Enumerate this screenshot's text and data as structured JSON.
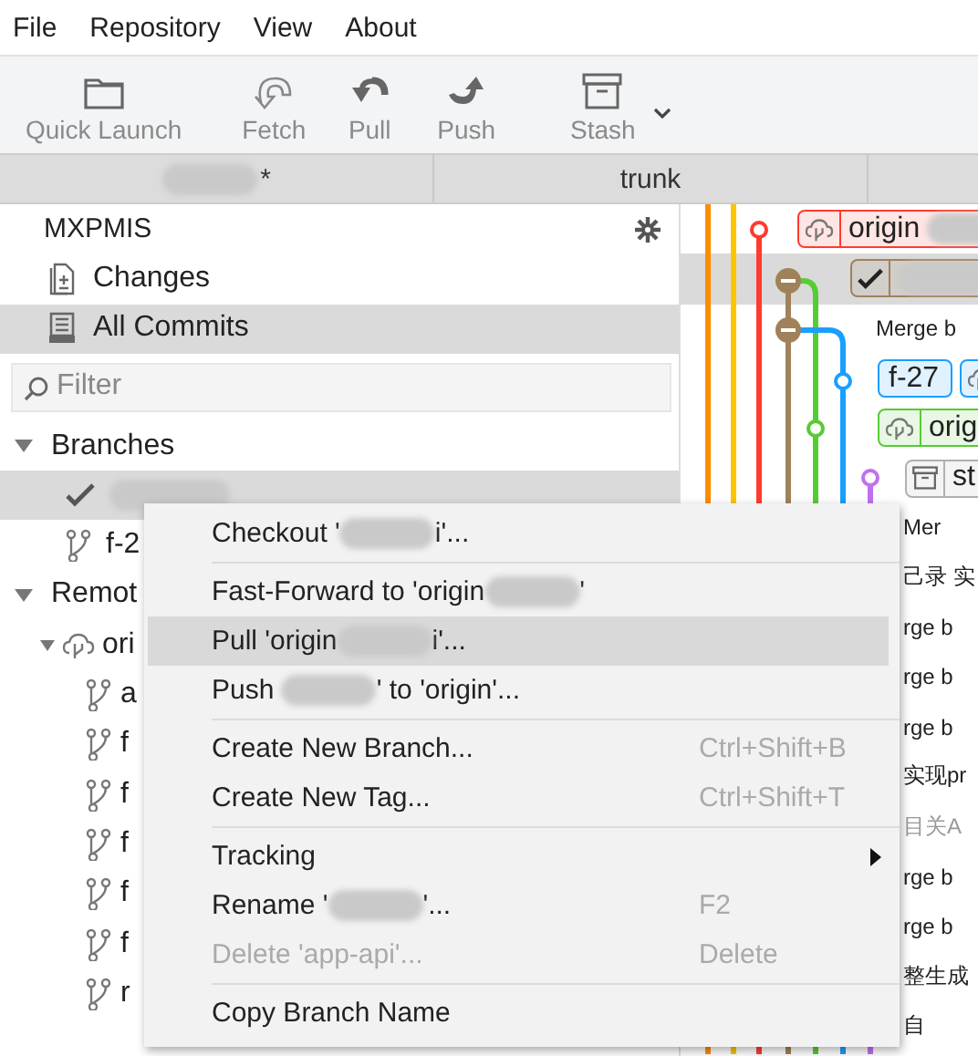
{
  "menu_bar": [
    "File",
    "Repository",
    "View",
    "About"
  ],
  "toolbar": [
    {
      "label": "Quick Launch",
      "kind": "folder"
    },
    {
      "label": "Fetch",
      "kind": "fetch"
    },
    {
      "label": "Pull",
      "kind": "pull"
    },
    {
      "label": "Push",
      "kind": "push"
    },
    {
      "label": "Stash",
      "kind": "stash",
      "dropdown": true
    }
  ],
  "tabs": [
    {
      "redacted": true,
      "label": "*"
    },
    {
      "redacted": false,
      "label": "trunk"
    }
  ],
  "sidebar": {
    "repo": "MXPMIS",
    "views": [
      {
        "label": "Changes",
        "kind": "changes",
        "selected": false
      },
      {
        "label": "All Commits",
        "kind": "commits",
        "selected": true
      }
    ],
    "filter": {
      "placeholder": "Filter"
    },
    "sections": [
      {
        "title": "Branches",
        "expanded": true,
        "items": [
          {
            "current": true,
            "selected": true,
            "redacted": true
          },
          {
            "current": false,
            "selected": false,
            "label": "f-2"
          }
        ]
      },
      {
        "title": "Remot",
        "expanded": true,
        "items": [
          {
            "label": "ori",
            "kind": "remote",
            "expanded": true,
            "children": [
              {
                "label": "a"
              },
              {
                "label": "f"
              },
              {
                "label": "f"
              },
              {
                "label": "f"
              },
              {
                "label": "f"
              },
              {
                "label": "f"
              },
              {
                "label": "r"
              }
            ]
          }
        ]
      }
    ]
  },
  "graph": {
    "rows": [
      {
        "selected": false,
        "refs": [
          {
            "kind": "remote",
            "label": "origin",
            "color": "#ff3b30",
            "redacted": true
          }
        ]
      },
      {
        "selected": true,
        "refs": [
          {
            "kind": "current",
            "color": "#a0825a",
            "redacted": true
          }
        ]
      },
      {
        "selected": false,
        "message": "Merge b",
        "dim": false
      },
      {
        "selected": false,
        "refs": [
          {
            "kind": "local",
            "label": "f-27",
            "color": "#1a9fff",
            "redacted": false
          },
          {
            "kind": "remote",
            "color": "#1a9fff",
            "redacted": false
          }
        ]
      },
      {
        "selected": false,
        "refs": [
          {
            "kind": "remote",
            "label": "orig",
            "color": "#55cc33",
            "redacted": false
          }
        ]
      },
      {
        "selected": false,
        "refs": [
          {
            "kind": "stash",
            "label": "st",
            "color": "#b0b0b0",
            "redacted": false
          }
        ]
      },
      {
        "selected": false,
        "message": "Mer",
        "dim": false
      },
      {
        "selected": false,
        "message": "己录 实",
        "dim": false
      },
      {
        "selected": false,
        "message": "rge b",
        "dim": false
      },
      {
        "selected": false,
        "message": "rge b",
        "dim": false
      },
      {
        "selected": false,
        "message": "rge b",
        "dim": false
      },
      {
        "selected": false,
        "message": "实现pr",
        "dim": false
      },
      {
        "selected": false,
        "message": "目关A",
        "dim": true
      },
      {
        "selected": false,
        "message": "rge b",
        "dim": false
      },
      {
        "selected": false,
        "message": "rge b",
        "dim": false
      },
      {
        "selected": false,
        "message": "整生成",
        "dim": false
      },
      {
        "selected": false,
        "message": "自",
        "dim": false
      }
    ]
  },
  "context_menu": [
    {
      "kind": "item",
      "parts": [
        "Checkout '",
        "i'..."
      ],
      "selected": false,
      "disabled": false
    },
    {
      "kind": "separator"
    },
    {
      "kind": "item",
      "parts": [
        "Fast-Forward to 'origin",
        "'"
      ],
      "selected": false,
      "disabled": false
    },
    {
      "kind": "item",
      "parts": [
        "Pull 'origin",
        "i'..."
      ],
      "selected": true,
      "disabled": false
    },
    {
      "kind": "item",
      "parts": [
        "Push ",
        "' to 'origin'..."
      ],
      "selected": false,
      "disabled": false
    },
    {
      "kind": "separator"
    },
    {
      "kind": "item",
      "parts": [
        "Create New Branch..."
      ],
      "shortcut": "Ctrl+Shift+B",
      "selected": false,
      "disabled": false
    },
    {
      "kind": "item",
      "parts": [
        "Create New Tag..."
      ],
      "shortcut": "Ctrl+Shift+T",
      "selected": false,
      "disabled": false
    },
    {
      "kind": "separator"
    },
    {
      "kind": "item",
      "parts": [
        "Tracking"
      ],
      "submenu": true,
      "selected": false,
      "disabled": false
    },
    {
      "kind": "item",
      "parts": [
        "Rename '",
        "'..."
      ],
      "shortcut": "F2",
      "selected": false,
      "disabled": false
    },
    {
      "kind": "item",
      "parts": [
        "Delete 'app-api'..."
      ],
      "shortcut": "Delete",
      "selected": false,
      "disabled": true
    },
    {
      "kind": "separator"
    },
    {
      "kind": "item",
      "parts": [
        "Copy Branch Name"
      ],
      "selected": false,
      "disabled": false
    }
  ]
}
